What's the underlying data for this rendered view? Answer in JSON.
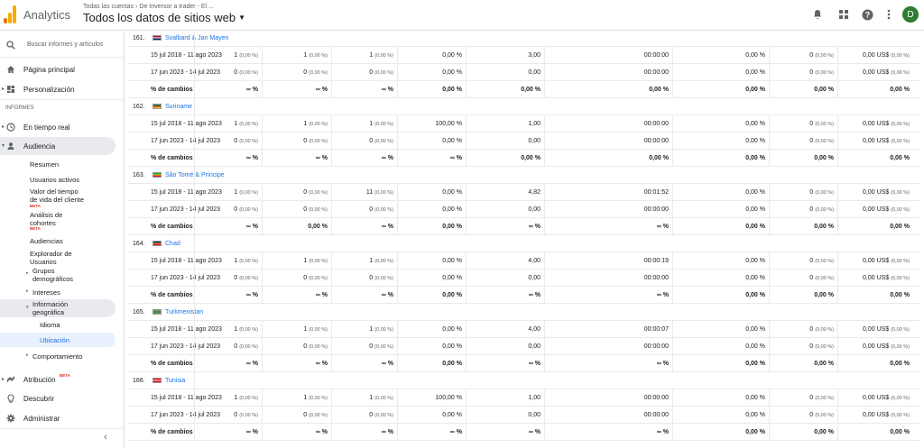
{
  "header": {
    "app_name": "Analytics",
    "breadcrumb": [
      "Todas las cuentas",
      "De Inversor a trader - El ..."
    ],
    "view_name": "Todos los datos de sitios web",
    "avatar_initial": "D",
    "colors": {
      "logo_orange": "#f9ab00",
      "logo_dark": "#e37400",
      "avatar": "#2e7d32"
    }
  },
  "sidebar": {
    "search_placeholder": "Buscar informes y artículos",
    "home": "Página principal",
    "custom": "Personalización",
    "section_reports": "INFORMES",
    "realtime": "En tiempo real",
    "audience": "Audiencia",
    "sub": {
      "overview": "Resumen",
      "active": "Usuarios activos",
      "ltv_line1": "Valor del tiempo",
      "ltv_line2": "de vida del cliente",
      "beta": "BETA",
      "cohort_line1": "Análisis de",
      "cohort_line2": "cohortes",
      "audiences": "Audiencias",
      "explorer_line1": "Explorador de",
      "explorer_line2": "Usuarios",
      "demo_line1": "Grupos",
      "demo_line2": "demográficos",
      "interests": "Intereses",
      "geo_line1": "Información",
      "geo_line2": "geográfica",
      "language": "Idioma",
      "location": "Ubicación",
      "behavior": "Comportamiento"
    },
    "attribution": "Atribución",
    "discover": "Descubrir",
    "admin": "Administrar"
  },
  "table": {
    "countries": [
      {
        "num": "161.",
        "name": "Svalbard & Jan Mayen",
        "flag": [
          "#ba0c2f",
          "#ffffff",
          "#00205b"
        ],
        "r1": [
          "15 jul 2018 - 11 ago 2023",
          "1",
          "(0,00 %)",
          "1",
          "(0,00 %)",
          "1",
          "(0,00 %)",
          "0,00 %",
          "3,00",
          "00:00:00",
          "0,00 %",
          "0",
          "(0,00 %)",
          "0,00 US$",
          "(0,00 %)"
        ],
        "r2": [
          "17 jun 2023 - 14 jul 2023",
          "0",
          "(0,00 %)",
          "0",
          "(0,00 %)",
          "0",
          "(0,00 %)",
          "0,00 %",
          "0,00",
          "00:00:00",
          "0,00 %",
          "0",
          "(0,00 %)",
          "0,00 US$",
          "(0,00 %)"
        ],
        "r3": [
          "% de cambios",
          "∞ %",
          "∞ %",
          "∞ %",
          "0,00 %",
          "0,00 %",
          "0,00 %",
          "0,00 %",
          "0,00 %",
          "0,00 %"
        ]
      },
      {
        "num": "162.",
        "name": "Suriname",
        "flag": [
          "#377e3f",
          "#b40a2d",
          "#ecc81d"
        ],
        "r1": [
          "15 jul 2018 - 11 ago 2023",
          "1",
          "(0,00 %)",
          "1",
          "(0,00 %)",
          "1",
          "(0,00 %)",
          "100,00 %",
          "1,00",
          "00:00:00",
          "0,00 %",
          "0",
          "(0,00 %)",
          "0,00 US$",
          "(0,00 %)"
        ],
        "r2": [
          "17 jun 2023 - 14 jul 2023",
          "0",
          "(0,00 %)",
          "0",
          "(0,00 %)",
          "0",
          "(0,00 %)",
          "0,00 %",
          "0,00",
          "00:00:00",
          "0,00 %",
          "0",
          "(0,00 %)",
          "0,00 US$",
          "(0,00 %)"
        ],
        "r3": [
          "% de cambios",
          "∞ %",
          "∞ %",
          "∞ %",
          "∞ %",
          "0,00 %",
          "0,00 %",
          "0,00 %",
          "0,00 %",
          "0,00 %"
        ]
      },
      {
        "num": "163.",
        "name": "São Tomé & Príncipe",
        "flag": [
          "#12ad2b",
          "#ffce00",
          "#d21034"
        ],
        "r1": [
          "15 jul 2018 - 11 ago 2023",
          "1",
          "(0,00 %)",
          "0",
          "(0,00 %)",
          "11",
          "(0,00 %)",
          "0,00 %",
          "4,82",
          "00:01:52",
          "0,00 %",
          "0",
          "(0,00 %)",
          "0,00 US$",
          "(0,00 %)"
        ],
        "r2": [
          "17 jun 2023 - 14 jul 2023",
          "0",
          "(0,00 %)",
          "0",
          "(0,00 %)",
          "0",
          "(0,00 %)",
          "0,00 %",
          "0,00",
          "00:00:00",
          "0,00 %",
          "0",
          "(0,00 %)",
          "0,00 US$",
          "(0,00 %)"
        ],
        "r3": [
          "% de cambios",
          "∞ %",
          "0,00 %",
          "∞ %",
          "0,00 %",
          "∞ %",
          "∞ %",
          "0,00 %",
          "0,00 %",
          "0,00 %"
        ]
      },
      {
        "num": "164.",
        "name": "Chad",
        "flag": [
          "#002664",
          "#fecb00",
          "#c60c30"
        ],
        "r1": [
          "15 jul 2018 - 11 ago 2023",
          "1",
          "(0,00 %)",
          "1",
          "(0,00 %)",
          "1",
          "(0,00 %)",
          "0,00 %",
          "4,00",
          "00:00:19",
          "0,00 %",
          "0",
          "(0,00 %)",
          "0,00 US$",
          "(0,00 %)"
        ],
        "r2": [
          "17 jun 2023 - 14 jul 2023",
          "0",
          "(0,00 %)",
          "0",
          "(0,00 %)",
          "0",
          "(0,00 %)",
          "0,00 %",
          "0,00",
          "00:00:00",
          "0,00 %",
          "0",
          "(0,00 %)",
          "0,00 US$",
          "(0,00 %)"
        ],
        "r3": [
          "% de cambios",
          "∞ %",
          "∞ %",
          "∞ %",
          "0,00 %",
          "∞ %",
          "∞ %",
          "0,00 %",
          "0,00 %",
          "0,00 %"
        ]
      },
      {
        "num": "165.",
        "name": "Turkmenistan",
        "flag": [
          "#28ae66",
          "#ca3745",
          "#28ae66"
        ],
        "r1": [
          "15 jul 2018 - 11 ago 2023",
          "1",
          "(0,00 %)",
          "1",
          "(0,00 %)",
          "1",
          "(0,00 %)",
          "0,00 %",
          "4,00",
          "00:00:07",
          "0,00 %",
          "0",
          "(0,00 %)",
          "0,00 US$",
          "(0,00 %)"
        ],
        "r2": [
          "17 jun 2023 - 14 jul 2023",
          "0",
          "(0,00 %)",
          "0",
          "(0,00 %)",
          "0",
          "(0,00 %)",
          "0,00 %",
          "0,00",
          "00:00:00",
          "0,00 %",
          "0",
          "(0,00 %)",
          "0,00 US$",
          "(0,00 %)"
        ],
        "r3": [
          "% de cambios",
          "∞ %",
          "∞ %",
          "∞ %",
          "0,00 %",
          "∞ %",
          "∞ %",
          "0,00 %",
          "0,00 %",
          "0,00 %"
        ]
      },
      {
        "num": "166.",
        "name": "Tunisia",
        "flag": [
          "#e70013",
          "#ffffff",
          "#e70013"
        ],
        "r1": [
          "15 jul 2018 - 11 ago 2023",
          "1",
          "(0,00 %)",
          "1",
          "(0,00 %)",
          "1",
          "(0,00 %)",
          "100,00 %",
          "1,00",
          "00:00:00",
          "0,00 %",
          "0",
          "(0,00 %)",
          "0,00 US$",
          "(0,00 %)"
        ],
        "r2": [
          "17 jun 2023 - 14 jul 2023",
          "0",
          "(0,00 %)",
          "0",
          "(0,00 %)",
          "0",
          "(0,00 %)",
          "0,00 %",
          "0,00",
          "00:00:00",
          "0,00 %",
          "0",
          "(0,00 %)",
          "0,00 US$",
          "(0,00 %)"
        ],
        "r3": [
          "% de cambios",
          "∞ %",
          "∞ %",
          "∞ %",
          "∞ %",
          "∞ %",
          "∞ %",
          "0,00 %",
          "0,00 %",
          "0,00 %"
        ]
      }
    ]
  }
}
